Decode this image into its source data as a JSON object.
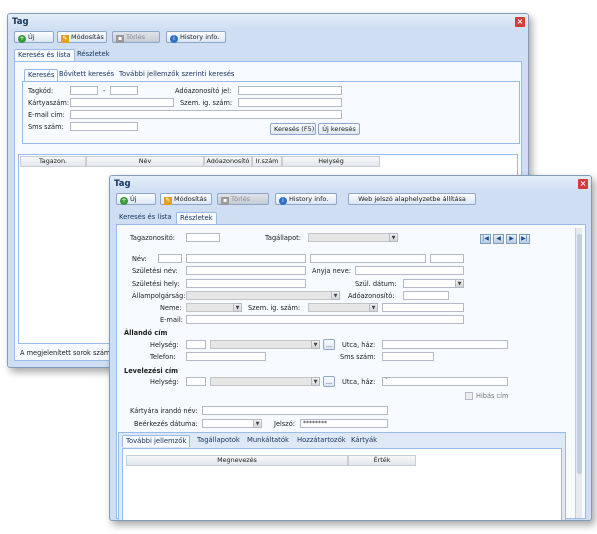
{
  "back_window": {
    "title": "Tag",
    "toolbar": {
      "new": "Új",
      "edit": "Módosítás",
      "delete": "Törlés",
      "history": "History info."
    },
    "tabs": [
      "Keresés és lista",
      "Részletek"
    ],
    "subtabs": [
      "Keresés",
      "Bővített keresés",
      "További jellemzők szerinti keresés"
    ],
    "fields": {
      "tagkod": "Tagkód:",
      "dash": "-",
      "adoazon": "Adóazonosító jel:",
      "kartyaszam": "Kártyaszám:",
      "szemig": "Szem. ig. szám:",
      "email": "E-mail cím:",
      "sms": "Sms szám:"
    },
    "buttons": {
      "search": "Keresés (F5)",
      "new_search": "Új keresés"
    },
    "grid_headers": [
      "Tagazon.",
      "Név",
      "Adóazonosító",
      "Ir.szám",
      "Helység"
    ],
    "status": "A megjelenített sorok száma"
  },
  "front_window": {
    "title": "Tag",
    "toolbar": {
      "new": "Új",
      "edit": "Módosítás",
      "delete": "Törlés",
      "history": "History info.",
      "web_reset": "Web jelszó alaphelyzetbe állítása"
    },
    "tabs": [
      "Keresés és lista",
      "Részletek"
    ],
    "labels": {
      "tagazon": "Tagazonosító:",
      "tagallapot": "Tagállapot:",
      "nev": "Név:",
      "szuletesi_nev": "Születési név:",
      "anyja_neve": "Anyja neve:",
      "szuletesi_hely": "Születési hely:",
      "szul_datum": "Szül. dátum:",
      "allampolgarsag": "Állampolgárság:",
      "adoazonosito": "Adóazonosító:",
      "neme": "Neme:",
      "szemig": "Szem. ig. szám:",
      "email": "E-mail:",
      "allando_cim": "Állandó cím",
      "helyseg": "Helység:",
      "utca": "Utca, ház:",
      "telefon": "Telefon:",
      "sms": "Sms szám:",
      "levelezesi_cim": "Levelezési cím",
      "helyseg2": "Helység:",
      "utca2": "Utca, ház:",
      "hibas_cim": "Hibás cím",
      "kartyara_nev": "Kártyára irandó név:",
      "beerkezes": "Beérkezés dátuma:",
      "jelszo": "Jelszó:"
    },
    "values": {
      "utca2": "`",
      "jelszo": "********",
      "ellipsis": "..."
    },
    "bottom_tabs": [
      "További jellemzők",
      "Tagállapotok",
      "Munkáltatók",
      "Hozzátartozók",
      "Kártyák"
    ],
    "grid_headers": [
      "Megnevezés",
      "Érték"
    ]
  }
}
